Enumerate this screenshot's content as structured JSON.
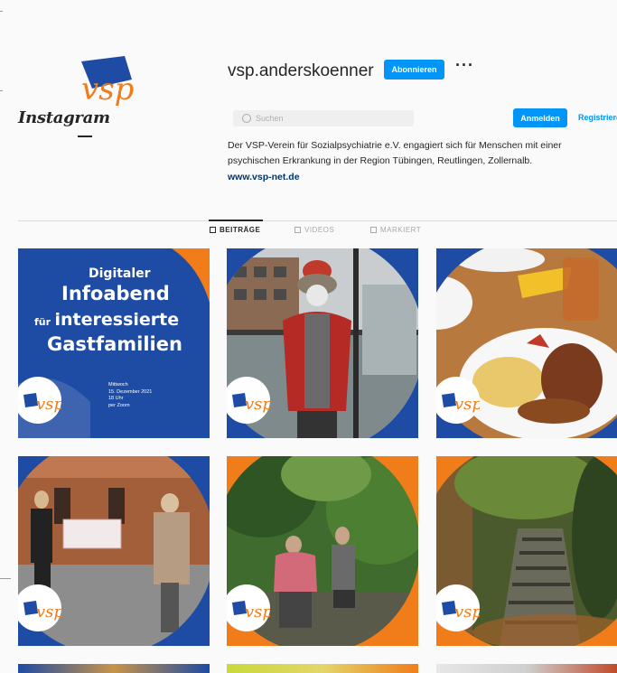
{
  "header": {
    "logo_text": "Instagram",
    "username": "vsp.anderskoenner",
    "follow_label": "Abonnieren",
    "more_label": "···",
    "search_placeholder": "Suchen",
    "login_label": "Anmelden",
    "register_label": "Registrieren"
  },
  "profile": {
    "avatar_text": "VSP",
    "bio": "Der VSP-Verein für Sozialpsychiatrie e.V. engagiert sich für Menschen mit einer psychischen Erkrankung in der Region Tübingen, Reutlingen, Zollernalb.",
    "link": "www.vsp-net.de"
  },
  "tabs": [
    {
      "label": "BEITRÄGE",
      "active": true
    },
    {
      "label": "VIDEOS",
      "active": false
    },
    {
      "label": "MARKIERT",
      "active": false
    }
  ],
  "posts": [
    {
      "id": "infoabend",
      "line1": "Digitaler",
      "line2": "Infoabend",
      "line3_small": "für",
      "line3": "interessierte",
      "line4": "Gastfamilien",
      "date_line1": "Mittwoch",
      "date_line2": "15. Dezember 2021",
      "date_line3": "18 Uhr",
      "date_line4": "per Zoom"
    },
    {
      "id": "person-window"
    },
    {
      "id": "food-plate"
    },
    {
      "id": "cheque-handover"
    },
    {
      "id": "two-women-garden"
    },
    {
      "id": "forest-stairs"
    }
  ],
  "badge_text": "vsp",
  "colors": {
    "brand_blue": "#1e4ba3",
    "brand_orange": "#f07d1a",
    "ig_blue": "#0095f6"
  }
}
